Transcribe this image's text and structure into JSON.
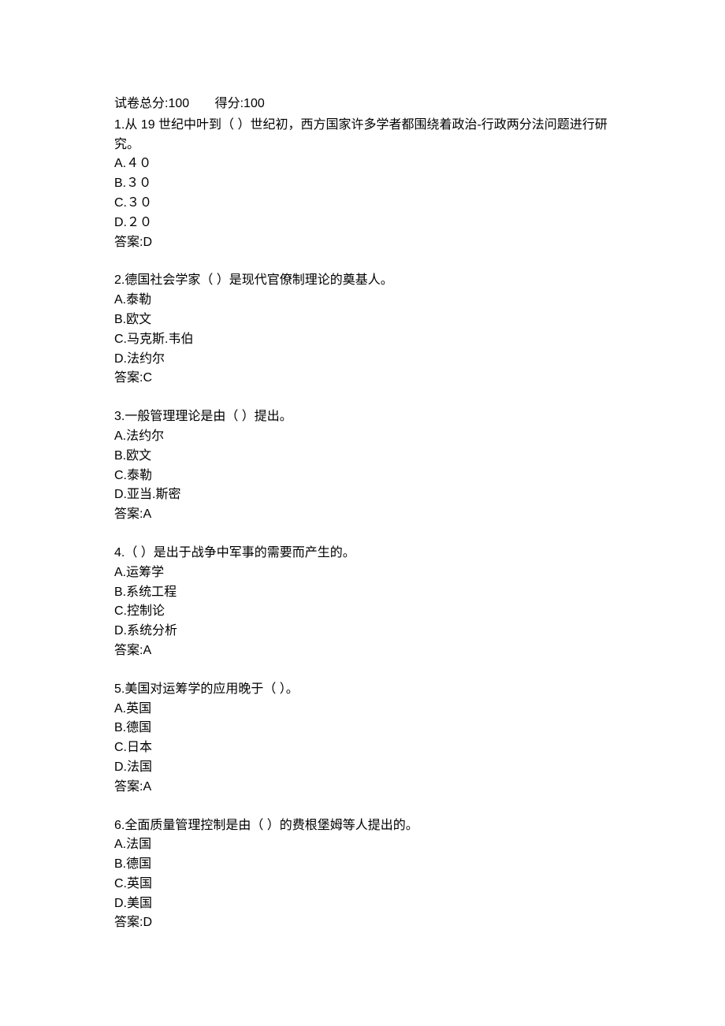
{
  "header": {
    "total_score_label": "试卷总分:100",
    "score_label": "得分:100"
  },
  "questions": [
    {
      "stem": "1.从 19 世纪中叶到（ ）世纪初，西方国家许多学者都围绕着政治-行政两分法问题进行研究。",
      "options": [
        "A.４０",
        "B.３０",
        "C.３０",
        "D.２０"
      ],
      "answer": "答案:D"
    },
    {
      "stem": "2.德国社会学家（ ）是现代官僚制理论的奠基人。",
      "options": [
        "A.泰勒",
        "B.欧文",
        "C.马克斯.韦伯",
        "D.法约尔"
      ],
      "answer": "答案:C"
    },
    {
      "stem": "3.一般管理理论是由（ ）提出。",
      "options": [
        "A.法约尔",
        "B.欧文",
        "C.泰勒",
        "D.亚当.斯密"
      ],
      "answer": "答案:A"
    },
    {
      "stem": "4.（ ）是出于战争中军事的需要而产生的。",
      "options": [
        "A.运筹学",
        "B.系统工程",
        "C.控制论",
        "D.系统分析"
      ],
      "answer": "答案:A"
    },
    {
      "stem": "5.美国对运筹学的应用晚于（ ）。",
      "options": [
        "A.英国",
        "B.德国",
        "C.日本",
        "D.法国"
      ],
      "answer": "答案:A"
    },
    {
      "stem": "6.全面质量管理控制是由（ ）的费根堡姆等人提出的。",
      "options": [
        "A.法国",
        "B.德国",
        "C.英国",
        "D.美国"
      ],
      "answer": "答案:D"
    }
  ]
}
